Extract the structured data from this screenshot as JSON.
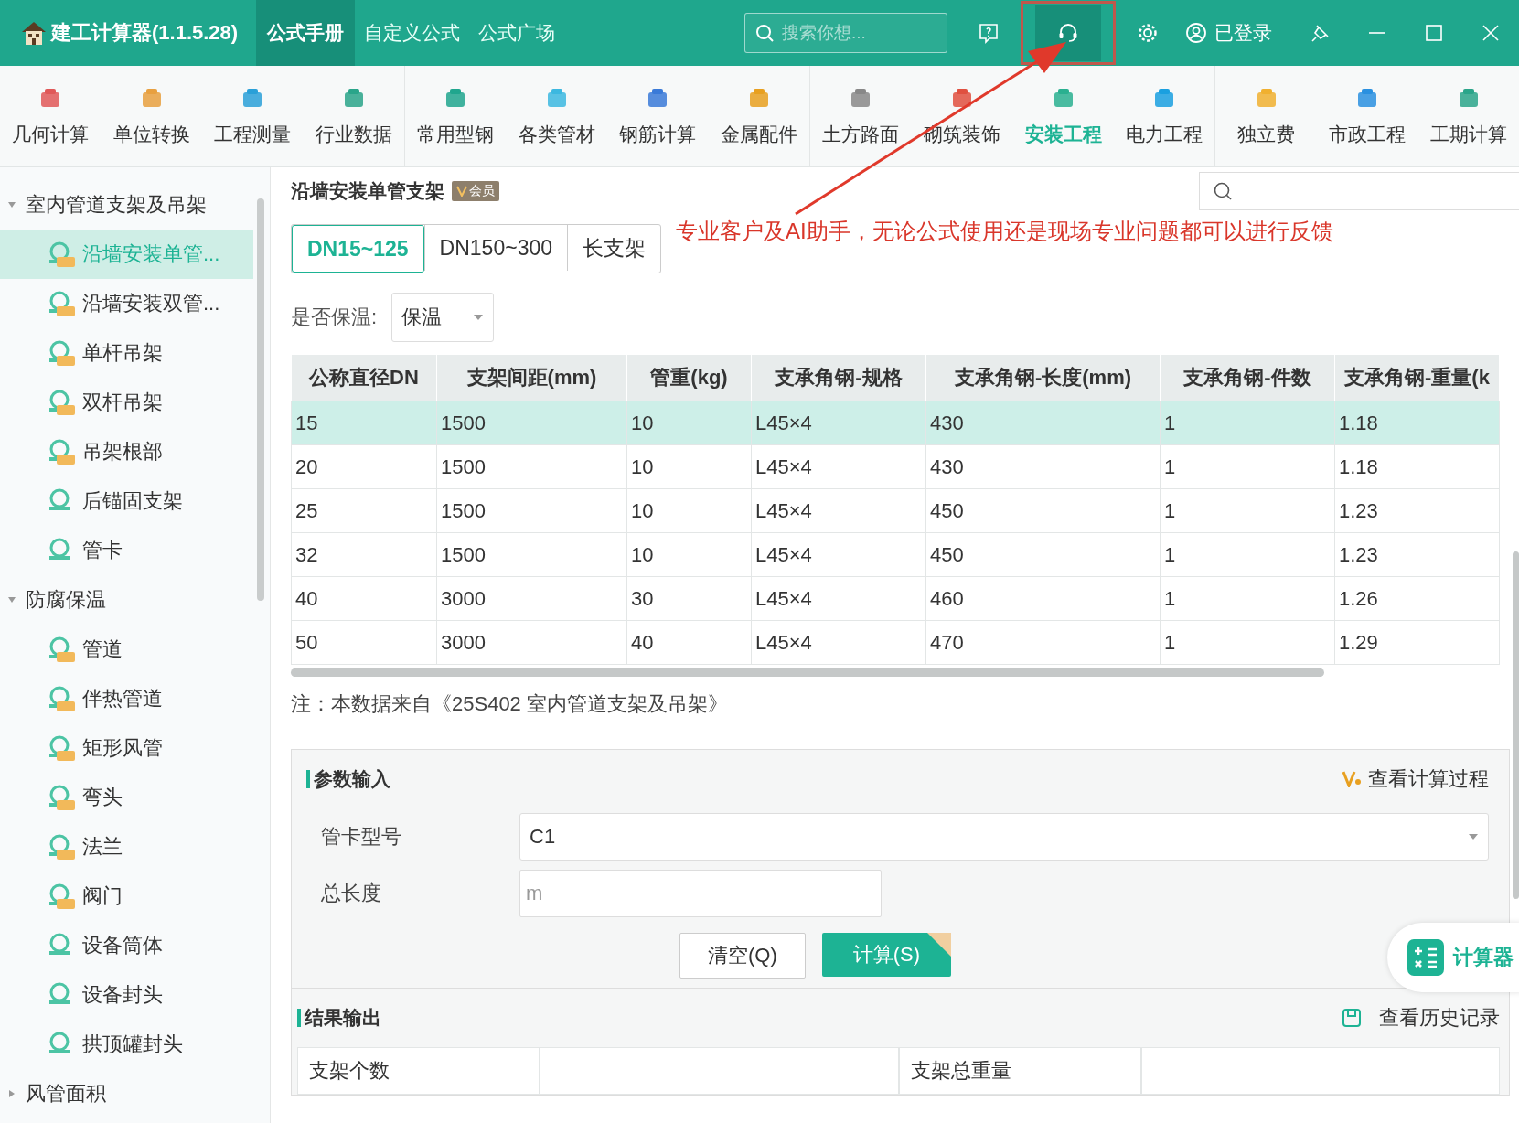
{
  "app": {
    "title": "建工计算器(1.1.5.28)"
  },
  "top_tabs": [
    {
      "label": "公式手册",
      "selected": true
    },
    {
      "label": "自定义公式",
      "selected": false
    },
    {
      "label": "公式广场",
      "selected": false
    }
  ],
  "top_search": {
    "placeholder": "搜索你想..."
  },
  "user": {
    "label": "已登录"
  },
  "toolbar": [
    {
      "label": "几何计算",
      "selected": false
    },
    {
      "label": "单位转换",
      "selected": false
    },
    {
      "label": "工程测量",
      "selected": false
    },
    {
      "label": "行业数据",
      "selected": false
    },
    {
      "label": "常用型钢",
      "selected": false
    },
    {
      "label": "各类管材",
      "selected": false
    },
    {
      "label": "钢筋计算",
      "selected": false
    },
    {
      "label": "金属配件",
      "selected": false
    },
    {
      "label": "土方路面",
      "selected": false
    },
    {
      "label": "砌筑装饰",
      "selected": false
    },
    {
      "label": "安装工程",
      "selected": true
    },
    {
      "label": "电力工程",
      "selected": false
    },
    {
      "label": "独立费",
      "selected": false
    },
    {
      "label": "市政工程",
      "selected": false
    },
    {
      "label": "工期计算",
      "selected": false
    }
  ],
  "sidebar": [
    {
      "label": "室内管道支架及吊架",
      "expanded": true,
      "children": [
        {
          "label": "沿墙安装单管...",
          "vip": true,
          "selected": true
        },
        {
          "label": "沿墙安装双管...",
          "vip": true,
          "selected": false
        },
        {
          "label": "单杆吊架",
          "vip": true,
          "selected": false
        },
        {
          "label": "双杆吊架",
          "vip": true,
          "selected": false
        },
        {
          "label": "吊架根部",
          "vip": true,
          "selected": false
        },
        {
          "label": "后锚固支架",
          "vip": false,
          "selected": false
        },
        {
          "label": "管卡",
          "vip": false,
          "selected": false
        }
      ]
    },
    {
      "label": "防腐保温",
      "expanded": true,
      "children": [
        {
          "label": "管道",
          "vip": true,
          "selected": false
        },
        {
          "label": "伴热管道",
          "vip": true,
          "selected": false
        },
        {
          "label": "矩形风管",
          "vip": true,
          "selected": false
        },
        {
          "label": "弯头",
          "vip": true,
          "selected": false
        },
        {
          "label": "法兰",
          "vip": true,
          "selected": false
        },
        {
          "label": "阀门",
          "vip": true,
          "selected": false
        },
        {
          "label": "设备筒体",
          "vip": false,
          "selected": false
        },
        {
          "label": "设备封头",
          "vip": false,
          "selected": false
        },
        {
          "label": "拱顶罐封头",
          "vip": false,
          "selected": false
        }
      ]
    },
    {
      "label": "风管面积",
      "expanded": false
    }
  ],
  "page": {
    "title": "沿墙安装单管支架",
    "badge": "会员"
  },
  "annotation": {
    "text": "专业客户及AI助手，无论公式使用还是现场专业问题都可以进行反馈"
  },
  "segments": [
    {
      "label": "DN15~125",
      "selected": true
    },
    {
      "label": "DN150~300",
      "selected": false
    },
    {
      "label": "长支架",
      "selected": false
    }
  ],
  "insulation": {
    "label": "是否保温:",
    "value": "保温"
  },
  "table": {
    "columns": [
      "公称直径DN",
      "支架间距(mm)",
      "管重(kg)",
      "支承角钢-规格",
      "支承角钢-长度(mm)",
      "支承角钢-件数",
      "支承角钢-重量(k"
    ],
    "rows": [
      {
        "cells": [
          "15",
          "1500",
          "10",
          "L45×4",
          "430",
          "1",
          "1.18"
        ],
        "selected": true
      },
      {
        "cells": [
          "20",
          "1500",
          "10",
          "L45×4",
          "430",
          "1",
          "1.18"
        ],
        "selected": false
      },
      {
        "cells": [
          "25",
          "1500",
          "10",
          "L45×4",
          "450",
          "1",
          "1.23"
        ],
        "selected": false
      },
      {
        "cells": [
          "32",
          "1500",
          "10",
          "L45×4",
          "450",
          "1",
          "1.23"
        ],
        "selected": false
      },
      {
        "cells": [
          "40",
          "3000",
          "30",
          "L45×4",
          "460",
          "1",
          "1.26"
        ],
        "selected": false
      },
      {
        "cells": [
          "50",
          "3000",
          "40",
          "L45×4",
          "470",
          "1",
          "1.29"
        ],
        "selected": false
      }
    ]
  },
  "note": "注：本数据来自《25S402 室内管道支架及吊架》",
  "input_panel": {
    "title": "参数输入",
    "process_link": "查看计算过程",
    "fields": [
      {
        "kind": "select",
        "label": "管卡型号",
        "value": "C1"
      },
      {
        "kind": "text",
        "label": "总长度",
        "placeholder": "m"
      }
    ],
    "buttons": [
      {
        "kind": "plain",
        "label": "清空(Q)"
      },
      {
        "kind": "primary",
        "label": "计算(S)"
      }
    ]
  },
  "calculator": {
    "label": "计算器"
  },
  "result_panel": {
    "title": "结果输出",
    "history_link": "查看历史记录",
    "cells": [
      "支架个数",
      "",
      "支架总重量",
      ""
    ]
  }
}
